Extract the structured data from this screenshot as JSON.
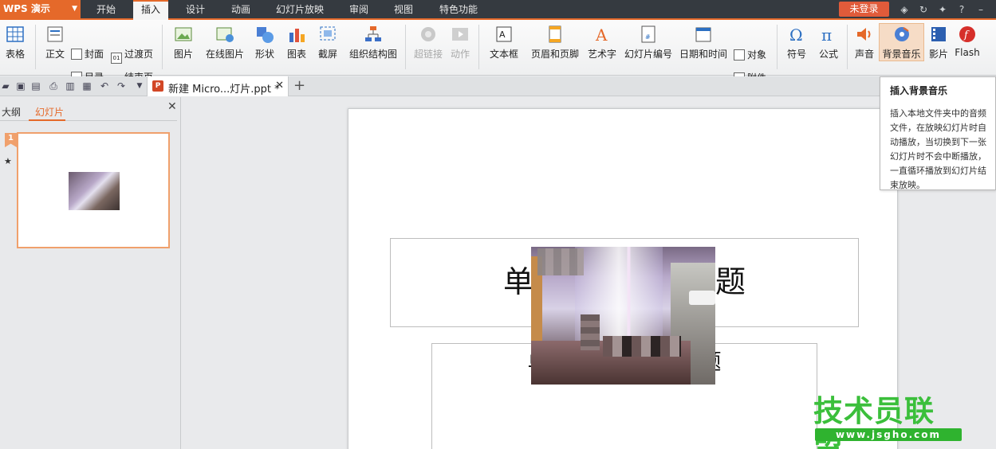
{
  "app": {
    "name": "WPS 演示"
  },
  "menu": {
    "tabs": [
      "开始",
      "插入",
      "设计",
      "动画",
      "幻灯片放映",
      "审阅",
      "视图",
      "特色功能"
    ],
    "active_tab": "插入",
    "login_label": "未登录"
  },
  "ribbon": {
    "table": "表格",
    "cover": "封面",
    "transition": "过渡页",
    "body": "正文",
    "toc": "目录",
    "end_page": "结束页",
    "picture": "图片",
    "online_picture": "在线图片",
    "shapes": "形状",
    "chart": "图表",
    "screenshot": "截屏",
    "org_chart": "组织结构图",
    "hyperlink": "超链接",
    "action": "动作",
    "textbox": "文本框",
    "header_footer": "页眉和页脚",
    "wordart": "艺术字",
    "slide_number": "幻灯片编号",
    "date_time": "日期和时间",
    "object": "对象",
    "attachment": "附件",
    "symbol": "符号",
    "formula": "公式",
    "sound": "声音",
    "bg_music": "背景音乐",
    "movie": "影片",
    "flash": "Flash"
  },
  "document": {
    "tab_title": "新建 Micro...灯片.ppt *"
  },
  "left_panel": {
    "outline_tab": "大纲",
    "slides_tab": "幻灯片",
    "slide_number": "1"
  },
  "slide": {
    "title_text": "单击此处添加标题",
    "subtitle_text": "单击此处添加副标题"
  },
  "tooltip": {
    "title": "插入背景音乐",
    "body": "插入本地文件夹中的音频文件，在放映幻灯片时自动播放，当切换到下一张幻灯片时不会中断播放，一直循环播放到幻灯片结束放映。"
  },
  "watermark": {
    "text": "技术员联盟",
    "url": "www.jsgho.com"
  },
  "colors": {
    "accent": "#e5692a",
    "menubar": "#353a40",
    "login": "#e05b3a",
    "watermark_green": "#3bbf3b"
  },
  "icons": [
    "table-icon",
    "picture-icon",
    "shapes-icon",
    "chart-icon",
    "screenshot-icon",
    "org-chart-icon",
    "textbox-icon",
    "wordart-icon",
    "symbol-icon",
    "formula-icon",
    "sound-icon",
    "music-icon",
    "movie-icon",
    "flash-icon"
  ]
}
